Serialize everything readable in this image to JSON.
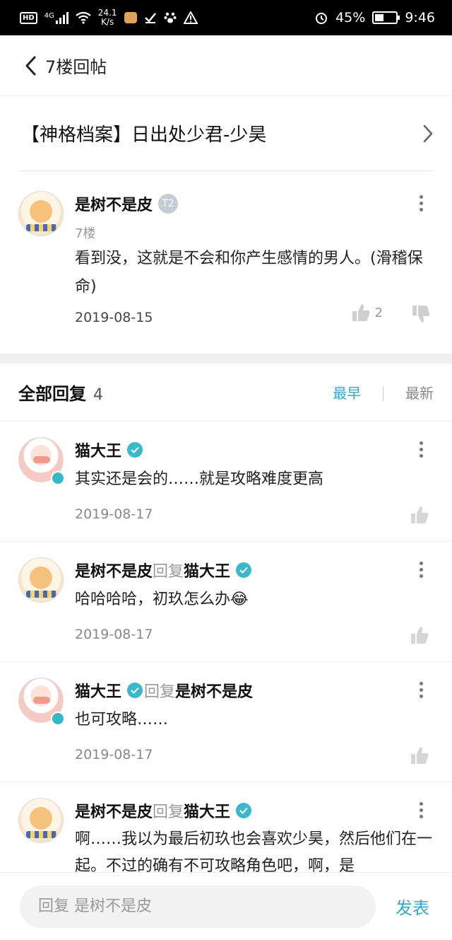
{
  "status_bar": {
    "hd": "HD",
    "network": "4G",
    "speed_value": "24.1",
    "speed_unit": "K/s",
    "battery": "45%",
    "time": "9:46"
  },
  "header": {
    "title": "7楼回帖"
  },
  "topic": {
    "title": "【神格档案】日出处少君-少昊"
  },
  "post": {
    "author": "是树不是皮",
    "level_badge": "T2",
    "floor": "7楼",
    "content": "看到没，这就是不会和你产生感情的男人。(滑稽保命)",
    "date": "2019-08-15",
    "like_count": "2"
  },
  "replies_section": {
    "title": "全部回复",
    "count": "4",
    "sort_earliest": "最早",
    "sort_latest": "最新"
  },
  "replies": [
    {
      "author": "猫大王",
      "reply_word": "",
      "reply_to": "",
      "content": "其实还是会的……就是攻略难度更高",
      "date": "2019-08-17"
    },
    {
      "author": "是树不是皮",
      "reply_word": "回复",
      "reply_to": "猫大王",
      "content": "哈哈哈哈，初玖怎么办😂",
      "date": "2019-08-17"
    },
    {
      "author": "猫大王",
      "reply_word": "回复",
      "reply_to": "是树不是皮",
      "content": "也可攻略……",
      "date": "2019-08-17"
    },
    {
      "author": "是树不是皮",
      "reply_word": "回复",
      "reply_to": "猫大王",
      "content": "啊……我以为最后初玖也会喜欢少昊，然后他们在一起。不过的确有不可攻略角色吧，啊，是",
      "date": ""
    }
  ],
  "bottom": {
    "placeholder": "回复 是树不是皮",
    "send_label": "发表"
  },
  "colors": {
    "accent": "#33aacc",
    "verified": "#3bb8c9"
  }
}
